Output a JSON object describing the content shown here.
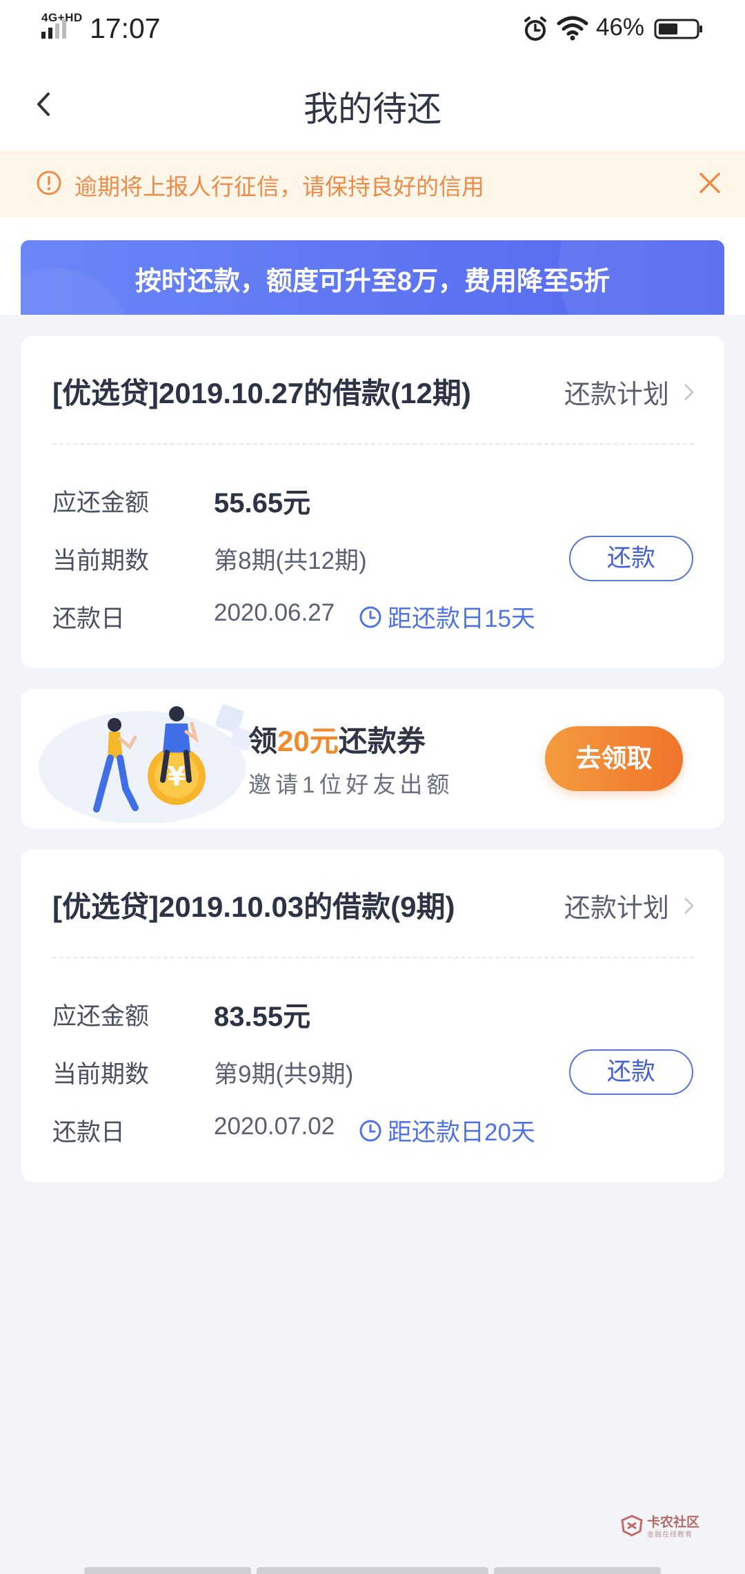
{
  "status_bar": {
    "network": "4G+HD",
    "time": "17:07",
    "battery": "46%",
    "icons": [
      "signal-icon",
      "alarm-icon",
      "wifi-icon",
      "battery-icon"
    ]
  },
  "header": {
    "title": "我的待还",
    "back_icon": "chevron-left-icon"
  },
  "notice": {
    "text": "逾期将上报人行征信，请保持良好的信用",
    "icon": "warning-icon",
    "close_icon": "close-icon",
    "color": "#ee8b48"
  },
  "promo": {
    "text": "按时还款，额度可升至8万，费用降至5折"
  },
  "loans": [
    {
      "title": "[优选贷]2019.10.27的借款(12期)",
      "plan_label": "还款计划",
      "amount_label": "应还金额",
      "amount": "55.65元",
      "period_label": "当前期数",
      "period": "第8期(共12期)",
      "due_label": "还款日",
      "due_date": "2020.06.27",
      "due_hint": "距还款日15天",
      "repay_label": "还款"
    },
    {
      "title": "[优选贷]2019.10.03的借款(9期)",
      "plan_label": "还款计划",
      "amount_label": "应还金额",
      "amount": "83.55元",
      "period_label": "当前期数",
      "period": "第9期(共9期)",
      "due_label": "还款日",
      "due_date": "2020.07.02",
      "due_hint": "距还款日20天",
      "repay_label": "还款"
    }
  ],
  "invite": {
    "title_prefix": "领",
    "title_highlight": "20元",
    "title_suffix": "还款券",
    "subtitle": "邀请1位好友出额",
    "button": "去领取"
  },
  "watermark": {
    "name": "卡农社区",
    "tagline": "金融在线教育"
  },
  "colors": {
    "accent_blue": "#4f73e6",
    "accent_orange": "#f28a2a",
    "promo_gradient_start": "#6a86f7",
    "promo_gradient_end": "#5468ee"
  }
}
